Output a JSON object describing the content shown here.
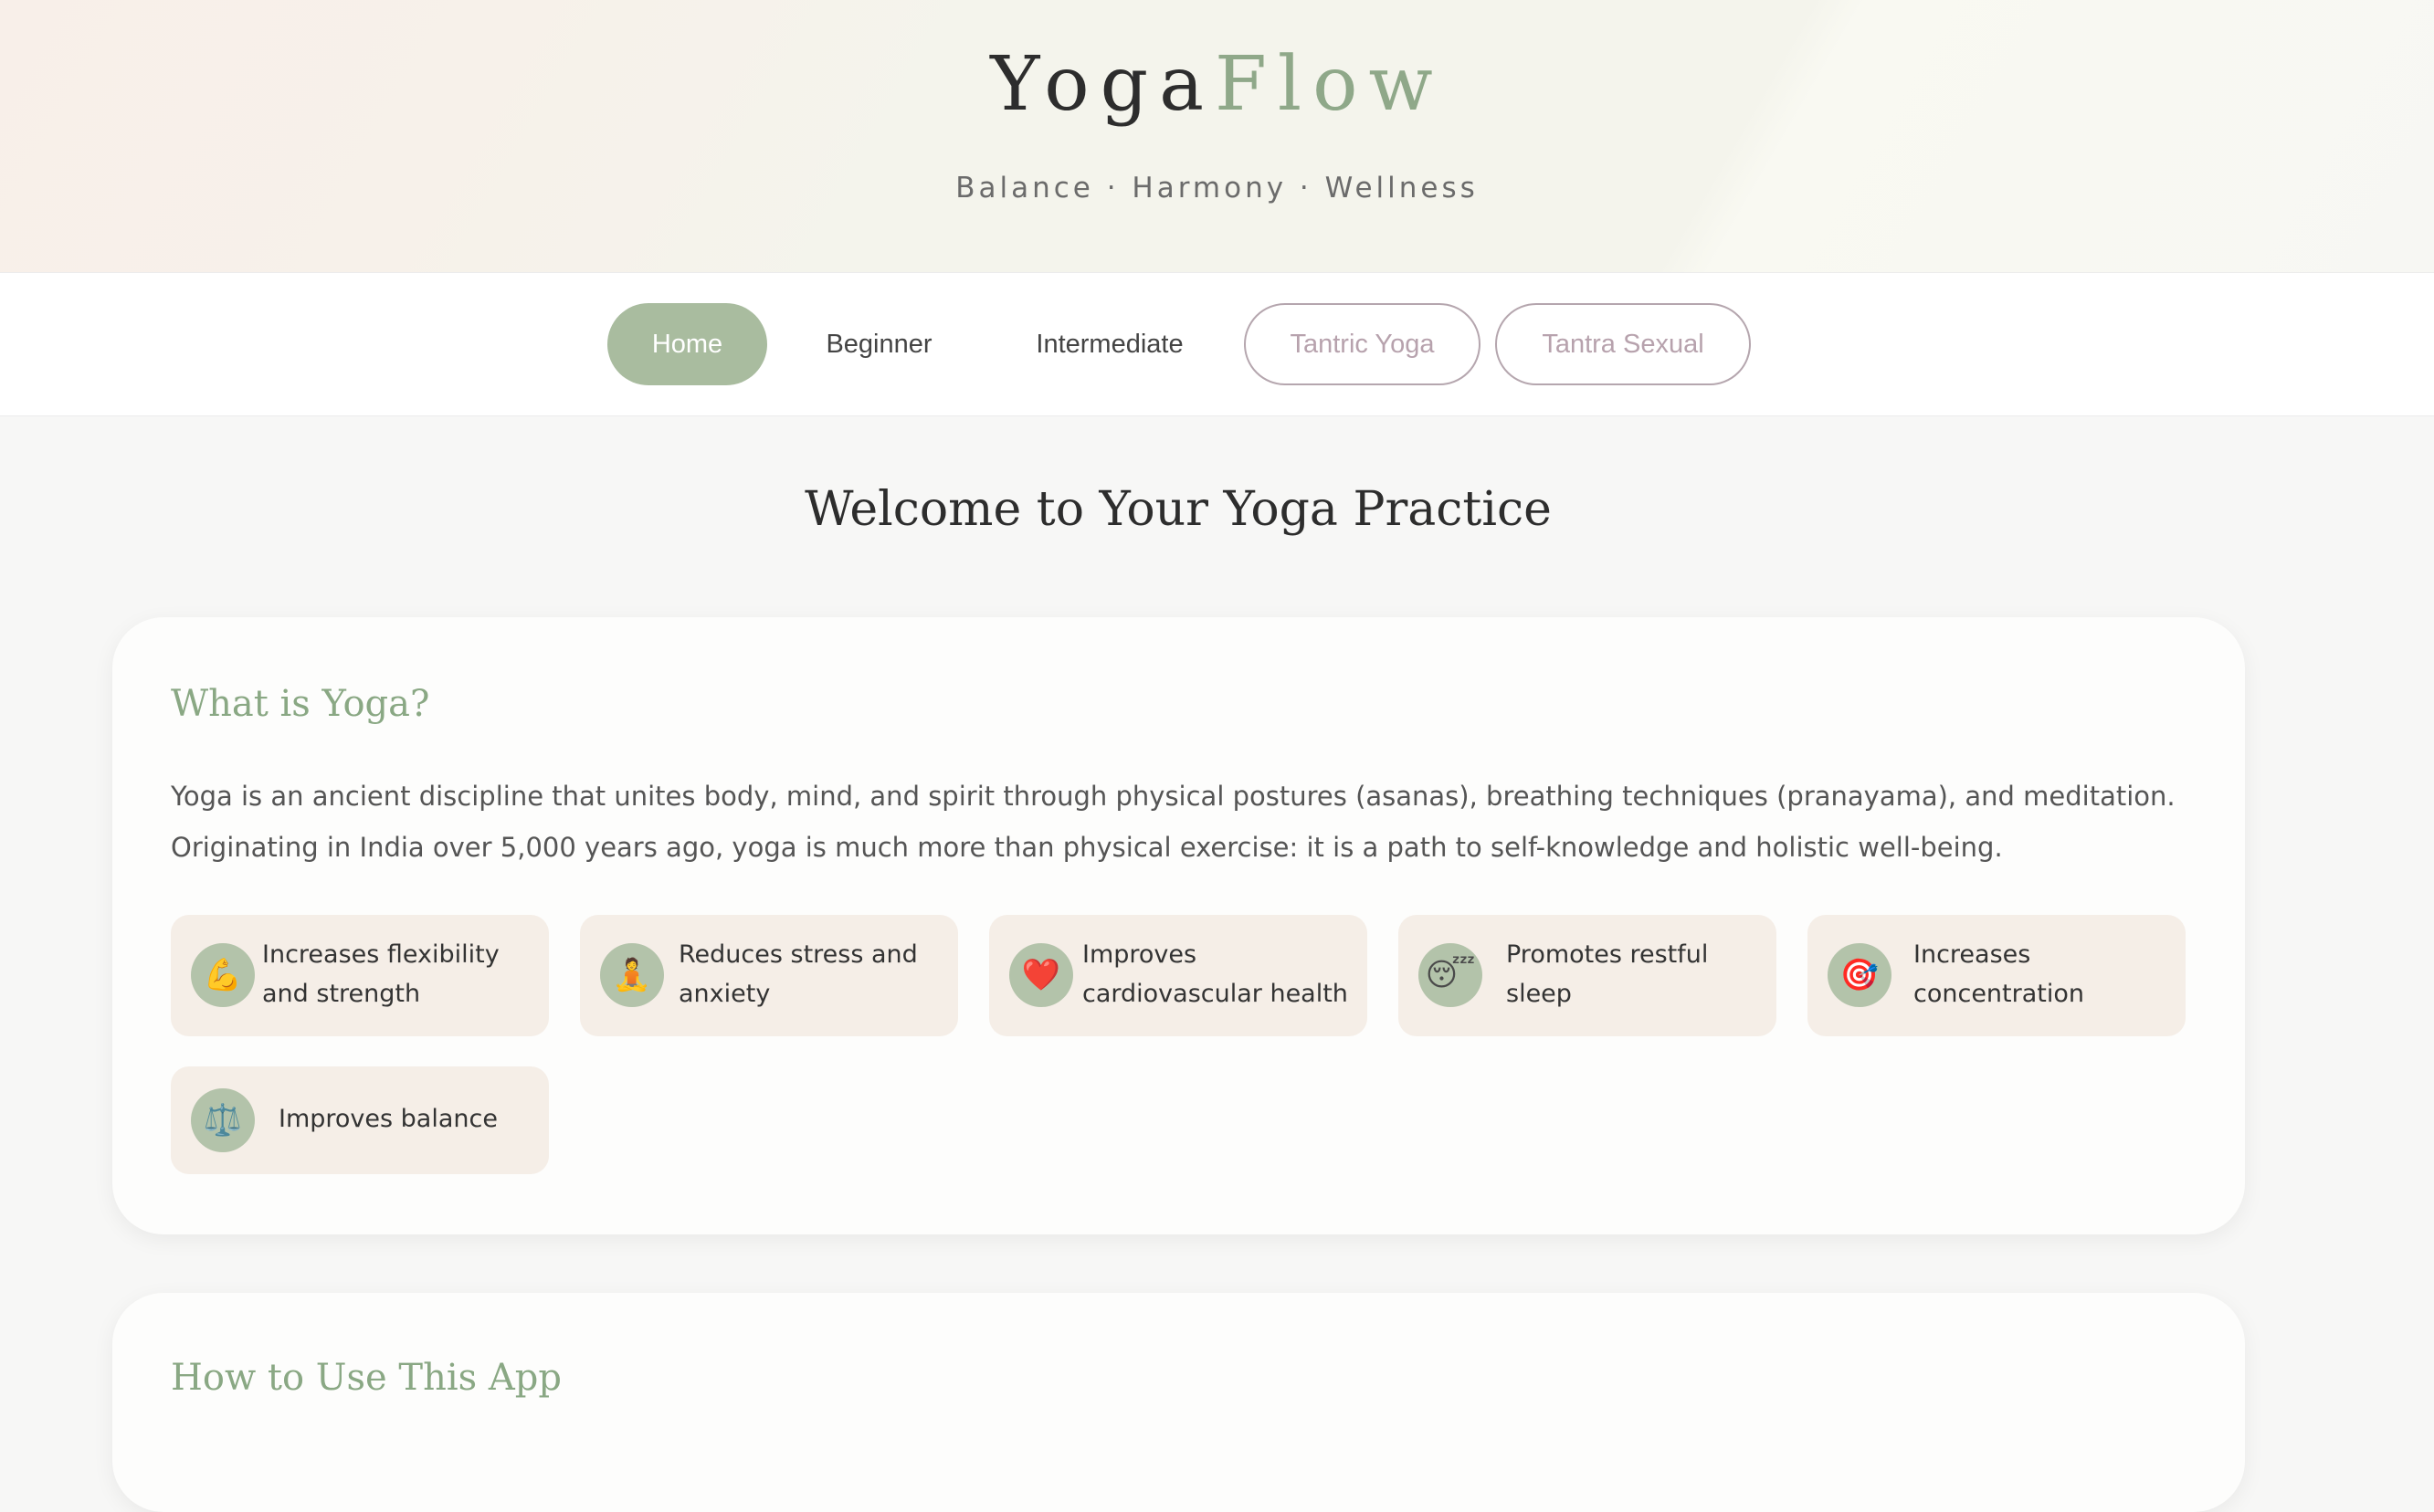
{
  "header": {
    "brand_part1": "Yoga",
    "brand_part2": "Flow",
    "tagline": "Balance · Harmony · Wellness"
  },
  "nav": {
    "items": [
      {
        "label": "Home",
        "active": true
      },
      {
        "label": "Beginner"
      },
      {
        "label": "Intermediate"
      },
      {
        "label": "Tantric Yoga"
      },
      {
        "label": "Tantra Sexual"
      }
    ]
  },
  "main": {
    "title": "Welcome to Your Yoga Practice",
    "what_is_yoga": {
      "title": "What is Yoga?",
      "text": "Yoga is an ancient discipline that unites body, mind, and spirit through physical postures (asanas), breathing techniques (pranayama), and meditation. Originating in India over 5,000 years ago, yoga is much more than physical exercise: it is a path to self-knowledge and holistic well-being.",
      "benefits": [
        {
          "icon": "💪",
          "icon_name": "flexed-biceps-icon",
          "label": "Increases flexibility and strength"
        },
        {
          "icon": "🧘",
          "icon_name": "meditation-icon",
          "label": "Reduces stress and anxiety"
        },
        {
          "icon": "❤️",
          "icon_name": "heart-icon",
          "label": "Improves cardiovascular health"
        },
        {
          "icon": "😴",
          "icon_name": "sleeping-face-icon",
          "label": "Promotes restful sleep"
        },
        {
          "icon": "🎯",
          "icon_name": "target-icon",
          "label": "Increases concentration"
        },
        {
          "icon": "⚖️",
          "icon_name": "balance-scale-icon",
          "label": "Improves balance"
        }
      ]
    },
    "how_to_use": {
      "title": "How to Use This App"
    }
  },
  "colors": {
    "accent": "#8fa889",
    "nav_active_bg": "#a9bc9f",
    "nav_outline": "#b5a6ae",
    "benefit_bg": "#f5eee7"
  }
}
